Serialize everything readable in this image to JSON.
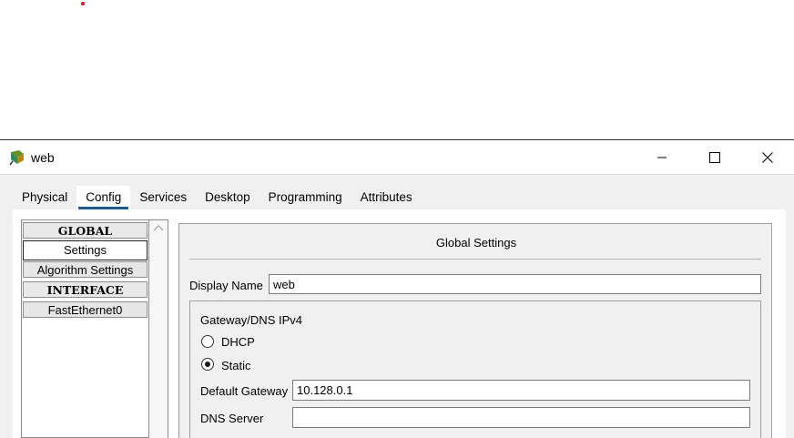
{
  "window": {
    "title": "web",
    "icon": "packet-tracer-server-icon"
  },
  "title_buttons": {
    "minimize": "minimize-icon",
    "maximize": "maximize-icon",
    "close": "close-icon"
  },
  "tabs": [
    {
      "label": "Physical",
      "active": false
    },
    {
      "label": "Config",
      "active": true
    },
    {
      "label": "Services",
      "active": false
    },
    {
      "label": "Desktop",
      "active": false
    },
    {
      "label": "Programming",
      "active": false
    },
    {
      "label": "Attributes",
      "active": false
    }
  ],
  "sidebar": {
    "items": [
      {
        "label": "GLOBAL",
        "type": "header"
      },
      {
        "label": "Settings",
        "type": "item",
        "selected": true
      },
      {
        "label": "Algorithm Settings",
        "type": "item"
      },
      {
        "label": "INTERFACE",
        "type": "header"
      },
      {
        "label": "FastEthernet0",
        "type": "item"
      }
    ]
  },
  "panel": {
    "title": "Global Settings",
    "display_name_label": "Display Name",
    "display_name_value": "web",
    "gateway_group": {
      "title": "Gateway/DNS IPv4",
      "dhcp_label": "DHCP",
      "dhcp_checked": false,
      "static_label": "Static",
      "static_checked": true,
      "default_gateway_label": "Default Gateway",
      "default_gateway_value": "10.128.0.1",
      "dns_server_label": "DNS Server",
      "dns_server_value": ""
    }
  },
  "colors": {
    "tab_underline": "#1e5a8c",
    "marker_dot": "#e81123"
  }
}
